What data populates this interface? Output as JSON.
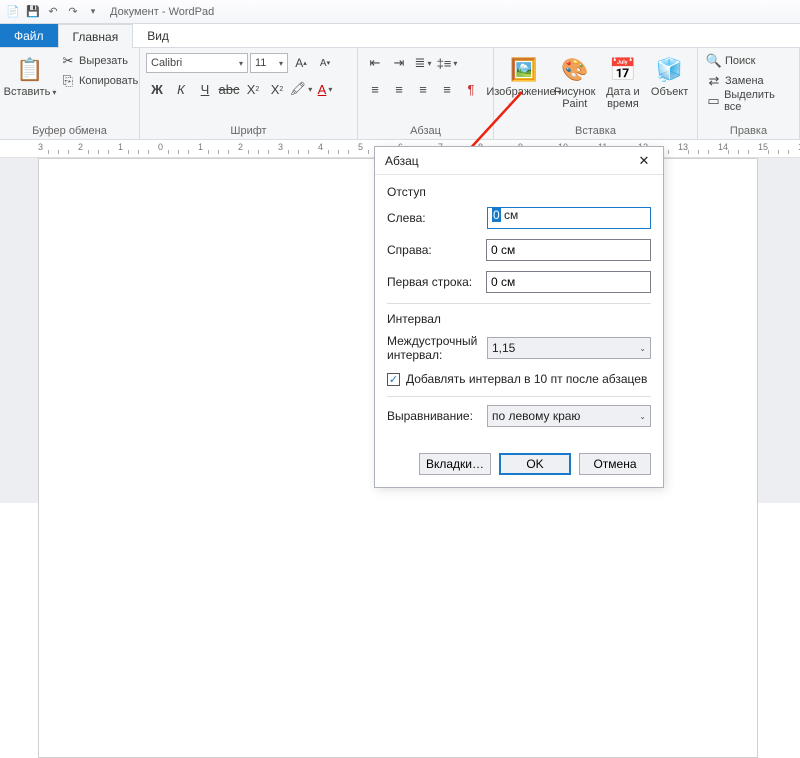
{
  "titlebar": {
    "title": "Документ - WordPad"
  },
  "tabs": {
    "file": "Файл",
    "home": "Главная",
    "view": "Вид"
  },
  "groups": {
    "clipboard": {
      "label": "Буфер обмена",
      "paste": "Вставить",
      "cut": "Вырезать",
      "copy": "Копировать"
    },
    "font": {
      "label": "Шрифт",
      "family": "Calibri",
      "size": "11"
    },
    "para": {
      "label": "Абзац"
    },
    "insert": {
      "label": "Вставка",
      "image": "Изображение",
      "paint": "Рисунок Paint",
      "datetime": "Дата и время",
      "object": "Объект"
    },
    "edit": {
      "label": "Правка",
      "find": "Поиск",
      "replace": "Замена",
      "select": "Выделить все"
    }
  },
  "dialog": {
    "title": "Абзац",
    "indent_label": "Отступ",
    "left": "Слева:",
    "right": "Справа:",
    "first": "Первая строка:",
    "val_left_prefix": "0",
    "val_left_unit": " см",
    "val_right": "0 см",
    "val_first": "0 см",
    "interval_label": "Интервал",
    "line_spacing": "Междустрочный интервал:",
    "line_val": "1,15",
    "add_space": "Добавлять интервал в 10 пт после абзацев",
    "align_label": "Выравнивание:",
    "align_val": "по левому краю",
    "tabs_btn": "Вкладки…",
    "ok": "OK",
    "cancel": "Отмена"
  }
}
